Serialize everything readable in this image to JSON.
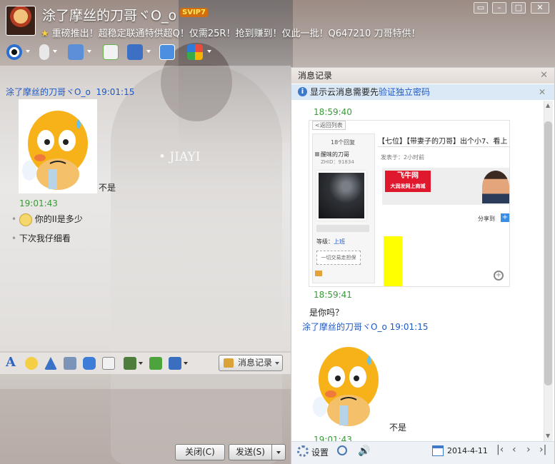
{
  "header": {
    "nickname": "涂了摩丝的刀哥ヾO_o",
    "svip_badge": "SVIP7",
    "signature": "重磅推出！超稳定联通特供超Q！仅需25R！抢到赚到！仅此一批！Q647210  刀哥特供！"
  },
  "window_controls": [
    "min",
    "max",
    "close"
  ],
  "chat": {
    "sender": "涂了摩丝的刀哥ヾO_o",
    "time1": "19:01:15",
    "sticker_caption": "不是",
    "time2": "19:01:43",
    "line1": "你的II是多少",
    "line2": "下次我仔细看",
    "watermark": "• JIAYI"
  },
  "input_toolbar": {
    "history_button": "消息记录"
  },
  "buttons": {
    "close": "关闭(C)",
    "send": "发送(S)"
  },
  "history": {
    "title": "消息记录",
    "notice_prefix": "显示云消息需要先",
    "notice_link": "验证独立密码",
    "entry_time1": "18:59:40",
    "shot": {
      "back_label": "<返回列表",
      "reply_count": "18个回复",
      "thread_title": "【七位】【带妻子的刀哥】出个小7、看上",
      "user_name": "醒味的刀哥",
      "user_id": "ZHID：91834",
      "post_time": "发表于：2小时前",
      "banner_brand": "飞牛网",
      "banner_slogan": "大润发网上商城",
      "share_label": "分享到",
      "level_label": "等级：",
      "level_value": "上班",
      "trade_button": "一切交易走担保"
    },
    "entry_time2": "18:59:41",
    "entry_text": "是你吗？",
    "entry_sender": "涂了摩丝的刀哥ヾO_o 19:01:15",
    "entry_sticker_caption": "不是",
    "entry_time3": "19:01:43",
    "footer": {
      "settings_label": "设置",
      "date": "2014-4-11"
    }
  }
}
